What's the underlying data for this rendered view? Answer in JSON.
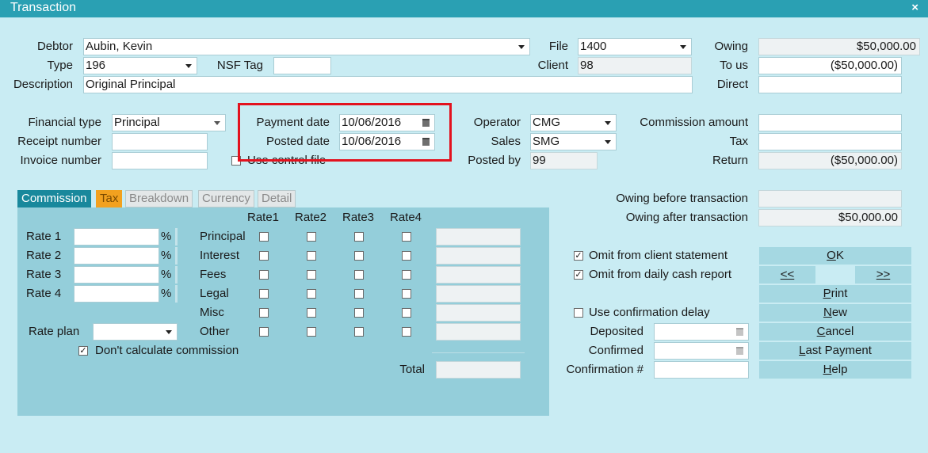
{
  "window": {
    "title": "Transaction",
    "close": "×"
  },
  "labels": {
    "debtor": "Debtor",
    "type": "Type",
    "nsf_tag": "NSF Tag",
    "description": "Description",
    "file": "File",
    "client": "Client",
    "owing": "Owing",
    "to_us": "To us",
    "direct": "Direct",
    "financial_type": "Financial type",
    "receipt_number": "Receipt number",
    "invoice_number": "Invoice number",
    "payment_date": "Payment date",
    "posted_date": "Posted date",
    "use_control_file": "Use control file",
    "operator": "Operator",
    "sales": "Sales",
    "posted_by": "Posted by",
    "commission_amount": "Commission amount",
    "tax": "Tax",
    "return": "Return",
    "owing_before": "Owing before transaction",
    "owing_after": "Owing after transaction"
  },
  "values": {
    "debtor": "Aubin, Kevin",
    "type": "196",
    "nsf_tag": "",
    "description": "Original Principal",
    "file": "1400",
    "client": "98",
    "owing": "$50,000.00",
    "to_us": "($50,000.00)",
    "direct": "",
    "financial_type": "Principal",
    "receipt_number": "",
    "invoice_number": "",
    "payment_date": "10/06/2016",
    "posted_date": "10/06/2016",
    "operator": "CMG",
    "sales": "SMG",
    "posted_by": "99",
    "commission_amount": "",
    "tax": "",
    "return": "($50,000.00)",
    "owing_before": "",
    "owing_after": "$50,000.00"
  },
  "tabs": [
    "Commission",
    "Tax",
    "Breakdown",
    "Currency",
    "Detail"
  ],
  "commission": {
    "rate_labels": [
      "Rate 1",
      "Rate 2",
      "Rate 3",
      "Rate 4"
    ],
    "percent_sign": "%",
    "rate_plan_label": "Rate plan",
    "rate_plan_value": "",
    "dont_calc_label": "Don't calculate commission",
    "dont_calc_checked": true,
    "column_headers": [
      "Rate1",
      "Rate2",
      "Rate3",
      "Rate4"
    ],
    "row_labels": [
      "Principal",
      "Interest",
      "Fees",
      "Legal",
      "Misc",
      "Other"
    ],
    "total_label": "Total"
  },
  "options": {
    "omit_client": "Omit from client statement",
    "omit_client_checked": true,
    "omit_cash": "Omit from daily cash report",
    "omit_cash_checked": true,
    "use_confirmation_delay": "Use confirmation delay",
    "use_confirmation_delay_checked": false,
    "deposited": "Deposited",
    "confirmed": "Confirmed",
    "confirmation_no": "Confirmation #"
  },
  "buttons": {
    "ok": [
      "",
      "O",
      "K"
    ],
    "prev": [
      "",
      "<",
      "<"
    ],
    "next": [
      ">",
      ">",
      ""
    ],
    "print": [
      "",
      "P",
      "rint"
    ],
    "new": [
      "",
      "N",
      "ew"
    ],
    "cancel": [
      "",
      "C",
      "ancel"
    ],
    "last_payment": [
      "",
      "L",
      "ast Payment"
    ],
    "help": [
      "",
      "H",
      "elp"
    ]
  },
  "colors": {
    "title_bar": "#2aa0b3",
    "background": "#c9ecf3",
    "panel": "#94ceda",
    "highlight": "#e3121e",
    "tab_active": "#19889c",
    "tab_tax": "#f2a11f"
  }
}
